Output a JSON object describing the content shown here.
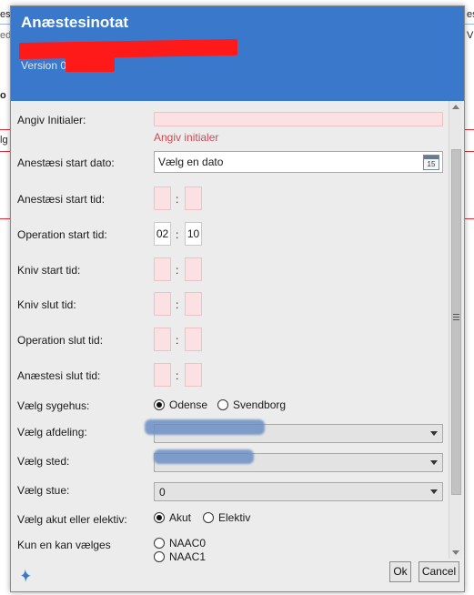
{
  "background": {
    "left_fragments": [
      "es",
      "ed",
      "o",
      "lg"
    ],
    "right_fragments": [
      "es",
      "V"
    ]
  },
  "dialog": {
    "title": "Anæstesinotat",
    "version_label": "Version 0.",
    "fields": {
      "initials_label": "Angiv Initialer:",
      "initials_error": "Angiv initialer",
      "start_date_label": "Anestæsi start dato:",
      "start_date_placeholder": "Vælg en dato",
      "calendar_icon_text": "15",
      "anesthesia_start_label": "Anestæsi start tid:",
      "operation_start_label": "Operation start tid:",
      "operation_start_hour": "02",
      "operation_start_minute": "10",
      "knife_start_label": "Kniv start tid:",
      "knife_end_label": "Kniv slut tid:",
      "operation_end_label": "Operation slut tid:",
      "anesthesia_end_label": "Anæstesi slut tid:",
      "time_separator": ":",
      "hospital_label": "Vælg sygehus:",
      "hospital_options": [
        "Odense",
        "Svendborg"
      ],
      "hospital_selected": "Odense",
      "department_label": "Vælg afdeling:",
      "location_label": "Vælg sted:",
      "room_label": "Vælg stue:",
      "room_value": "0",
      "urgency_label": "Vælg akut eller elektiv:",
      "urgency_options": [
        "Akut",
        "Elektiv"
      ],
      "urgency_selected": "Akut",
      "naac_label": "Kun en kan vælges",
      "naac_options": [
        "NAAC0",
        "NAAC1"
      ]
    },
    "buttons": {
      "ok": "Ok",
      "cancel": "Cancel"
    }
  },
  "colors": {
    "header": "#3a78cc",
    "invalid_fill": "#fbe0e4",
    "error_text": "#d04a52",
    "redaction": "#ff1a1a"
  }
}
